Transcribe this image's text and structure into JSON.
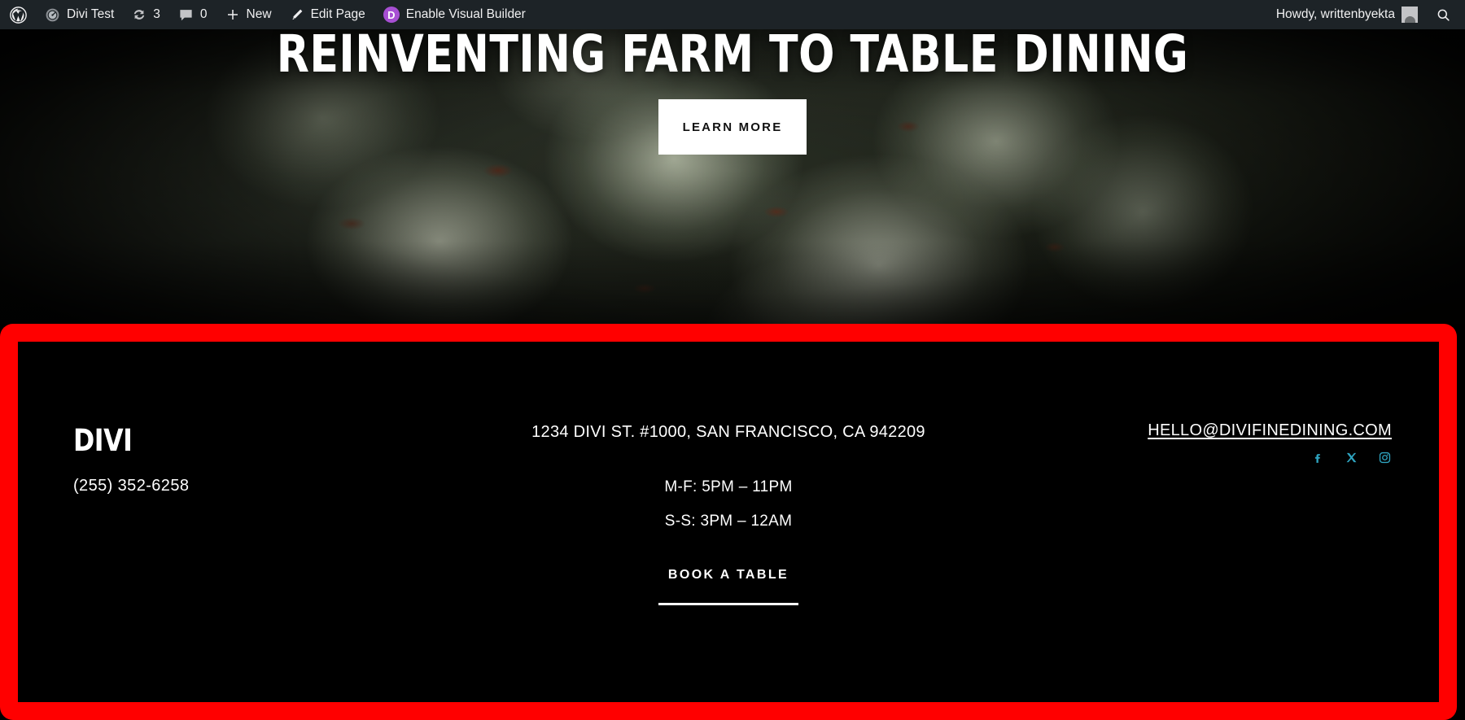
{
  "admin_bar": {
    "wp_logo_icon": "wordpress-logo-icon",
    "site_icon": "dashboard-gauge-icon",
    "site_name": "Divi Test",
    "revisions_icon": "update-revisions-icon",
    "revisions_count": "3",
    "comments_icon": "comment-bubble-icon",
    "comments_count": "0",
    "new_icon": "plus-icon",
    "new_label": "New",
    "edit_icon": "pencil-icon",
    "edit_label": "Edit Page",
    "divi_badge_letter": "D",
    "visual_builder_label": "Enable Visual Builder",
    "howdy": "Howdy, writtenbyekta",
    "avatar_icon": "user-avatar-icon",
    "search_icon": "search-icon",
    "bar_background": "#1d2327",
    "divi_badge_color": "#a74fd3"
  },
  "hero": {
    "title": "REINVENTING FARM TO TABLE DINING",
    "cta_label": "LEARN MORE",
    "background_description": "dark artichoke close-up photograph",
    "cta_background": "#ffffff",
    "cta_text_color": "#111111"
  },
  "footer": {
    "outline_color": "#ff0000",
    "background": "#000000",
    "logo": "DIVI",
    "phone": "(255) 352-6258",
    "address": "1234 DIVI ST. #1000, SAN FRANCISCO, CA 942209",
    "hours": [
      "M-F: 5PM – 11PM",
      "S-S: 3PM – 12AM"
    ],
    "email": "HELLO@DIVIFINEDINING.COM",
    "social": [
      {
        "name": "facebook-icon",
        "label": "Facebook"
      },
      {
        "name": "x-twitter-icon",
        "label": "X"
      },
      {
        "name": "instagram-icon",
        "label": "Instagram"
      }
    ],
    "social_color": "#2ea3bf",
    "book_label": "BOOK A TABLE"
  }
}
